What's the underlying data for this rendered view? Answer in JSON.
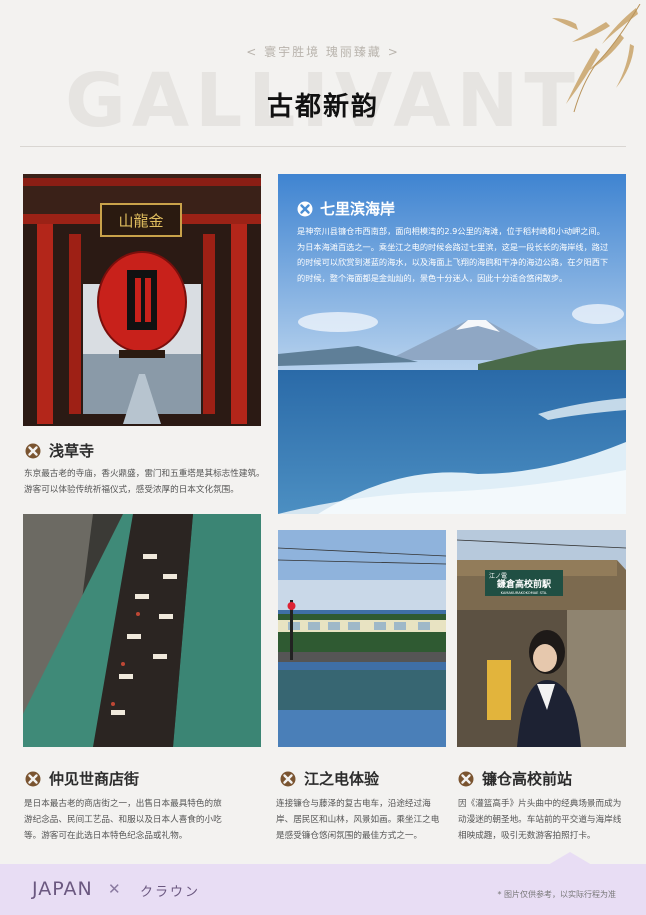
{
  "header": {
    "tagline": "< 寰宇胜境 瑰丽臻藏 >",
    "background_word": "GALLIVANT",
    "title": "古都新韵"
  },
  "sections": {
    "sensoji": {
      "title": "浅草寺",
      "icon": "cross-circle-icon",
      "description": "东京最古老的寺庙，香火鼎盛，雷门和五重塔是其标志性建筑。游客可以体验传统祈福仪式，感受浓厚的日本文化氛围。",
      "lantern_sign": "山龍金",
      "lantern_char": "門"
    },
    "shichirigahama": {
      "title": "七里滨海岸",
      "icon": "cross-circle-icon",
      "description": "是神奈川县镰仓市西南部，面向相模湾的2.9公里的海滩，位于稻村崎和小动岬之间。为日本海滩百选之一。乘坐江之电的时候会路过七里滨，这是一段长长的海岸线，路过的时候可以欣赏到湛蓝的海水，以及海面上飞翔的海鸥和干净的海边公路，在夕阳西下的时候，整个海面都是金灿灿的，景色十分迷人，因此十分适合悠闲散步。"
    },
    "nakamise": {
      "title": "仲见世商店街",
      "icon": "cross-circle-icon",
      "description": "是日本最古老的商店街之一，出售日本最具特色的旅游纪念品、民间工艺品、和服以及日本人喜食的小吃等。游客可在此选日本特色纪念品或礼物。"
    },
    "enoden": {
      "title": "江之电体验",
      "icon": "cross-circle-icon",
      "description": "连接镰仓与藤泽的复古电车，沿途经过海岸、居民区和山林，风景如画。乘坐江之电是感受镰仓悠闲氛围的最佳方式之一。"
    },
    "kamakurakokomae": {
      "title": "镰仓高校前站",
      "icon": "cross-circle-icon",
      "description": "因《灌篮高手》片头曲中的经典场景而成为动漫迷的朝圣地。车站前的平交道与海岸线相映成趣，吸引无数游客拍照打卡。",
      "station_sign": "江ノ電",
      "station_name": "鎌倉高校前駅",
      "station_romaji": "KAMAKURAKOKOMAE STA."
    }
  },
  "footer": {
    "left_text": "JAPAN",
    "separator": "✕",
    "right_text": "クラウン",
    "note": "* 图片仅供参考，以实际行程为准"
  },
  "colors": {
    "icon": "#7a5430",
    "footer_bg": "#e8ddf4",
    "sea_card_bg": "#4a8ed4"
  }
}
